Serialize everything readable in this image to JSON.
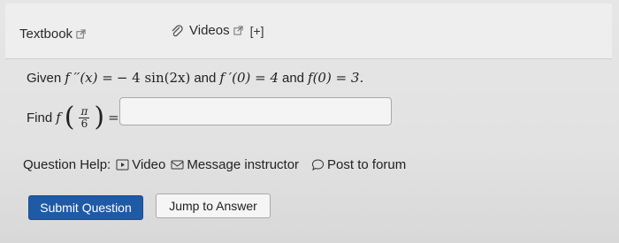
{
  "tabs": {
    "textbook_label": "Textbook",
    "videos_label": "Videos",
    "plus_label": "[+]"
  },
  "question": {
    "given_word": "Given",
    "f2_lhs": "f ′′(x) =",
    "f2_rhs": "− 4 sin(2x)",
    "and1": "and",
    "f1_expr": "f ′(0) = 4",
    "and2": "and",
    "f0_expr": "f(0) = 3.",
    "find_word": "Find",
    "find_f": "f",
    "frac_num": "π",
    "frac_den": "6",
    "equals": "=",
    "answer_value": ""
  },
  "help": {
    "label": "Question Help:",
    "video_label": "Video",
    "message_label": "Message instructor",
    "forum_label": "Post to forum"
  },
  "buttons": {
    "submit_label": "Submit Question",
    "jump_label": "Jump to Answer"
  },
  "colors": {
    "submit_bg": "#1f5aa6",
    "background": "#e4e4e4"
  }
}
